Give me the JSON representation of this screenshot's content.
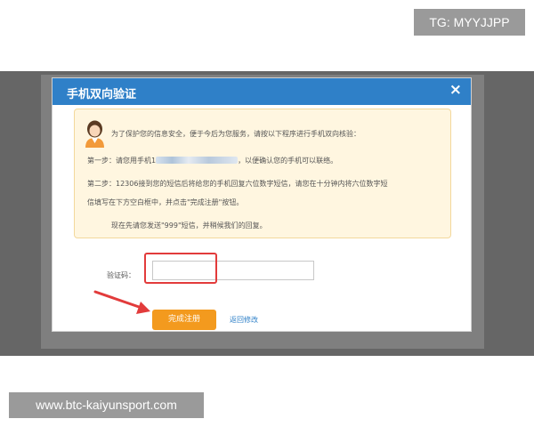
{
  "overlay": {
    "tg_badge": "TG: MYYJJPP",
    "site_watermark": "www.btc-kaiyunsport.com"
  },
  "dialog": {
    "title": "手机双向验证",
    "close_glyph": "×",
    "notice": {
      "line1": "为了保护您的信息安全，便于今后为您服务，请按以下程序进行手机双向核验：",
      "step1_prefix": "第一步：请您用手机1",
      "step1_suffix": "，以便确认您的手机可以联络。",
      "step2_line1": "第二步：12306接到您的短信后将给您的手机回复六位数字短信，请您在十分钟内将六位数字短",
      "step2_line2": "信填写在下方空白框中，并点击\"完成注册\"按钮。",
      "line5": "现在先请您发送\"999\"短信，并稍候我们的回复。"
    },
    "code_label": "验证码：",
    "code_value": "",
    "complete_button": "完成注册",
    "back_link": "返回修改"
  },
  "colors": {
    "header_blue": "#2f80c8",
    "notice_bg": "#fff6e0",
    "button_orange": "#f39a1e",
    "highlight_red": "#e23b3b"
  }
}
